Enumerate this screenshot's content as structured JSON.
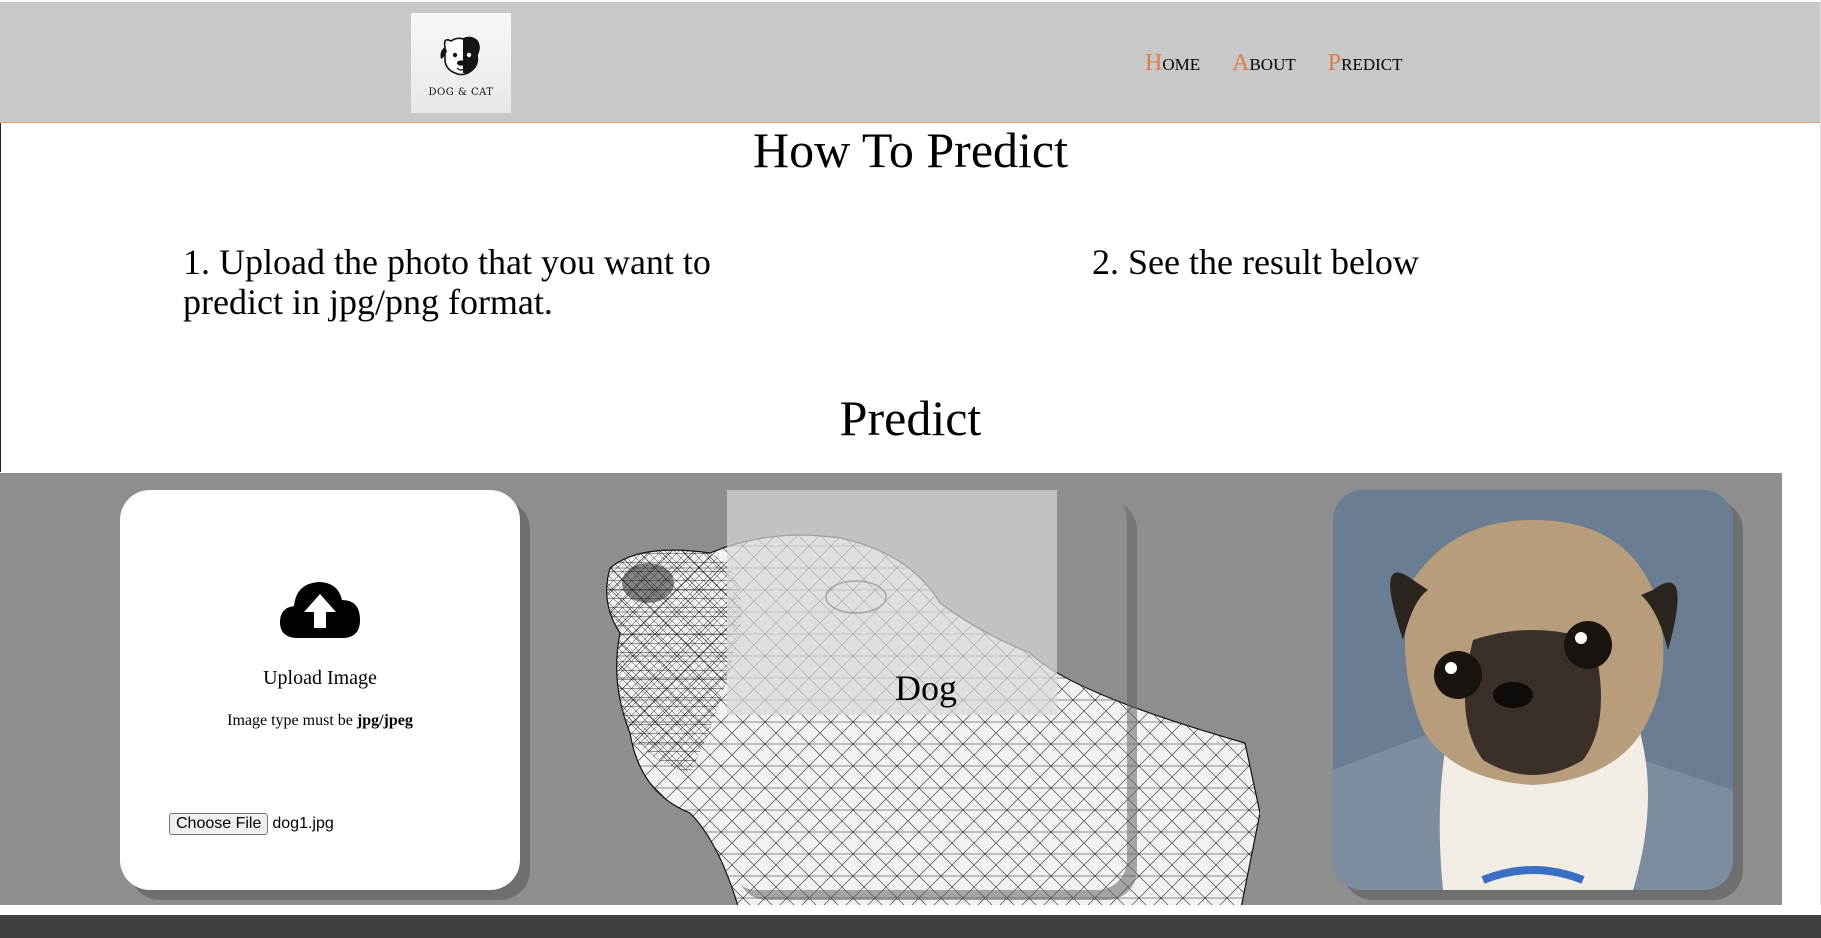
{
  "header": {
    "logo_text": "DOG & CAT",
    "nav": [
      {
        "first": "H",
        "rest": "OME"
      },
      {
        "first": "A",
        "rest": "BOUT"
      },
      {
        "first": "P",
        "rest": "REDICT"
      }
    ]
  },
  "how": {
    "title": "How To Predict",
    "step1": "1. Upload the photo that you want to predict in jpg/png format.",
    "step2": "2. See the result below"
  },
  "predict": {
    "title": "Predict",
    "upload_label": "Upload Image",
    "hint_prefix": "Image type must be ",
    "hint_format": "jpg/jpeg",
    "file_button": "Choose File",
    "file_name": "dog1.jpg",
    "result": "Dog"
  },
  "colors": {
    "header_bg": "#c8c8c8",
    "accent": "#e07a4a",
    "band_bg": "#8e8e8e",
    "footer_bg": "#404040"
  },
  "icons": [
    "cloud-upload-icon"
  ]
}
